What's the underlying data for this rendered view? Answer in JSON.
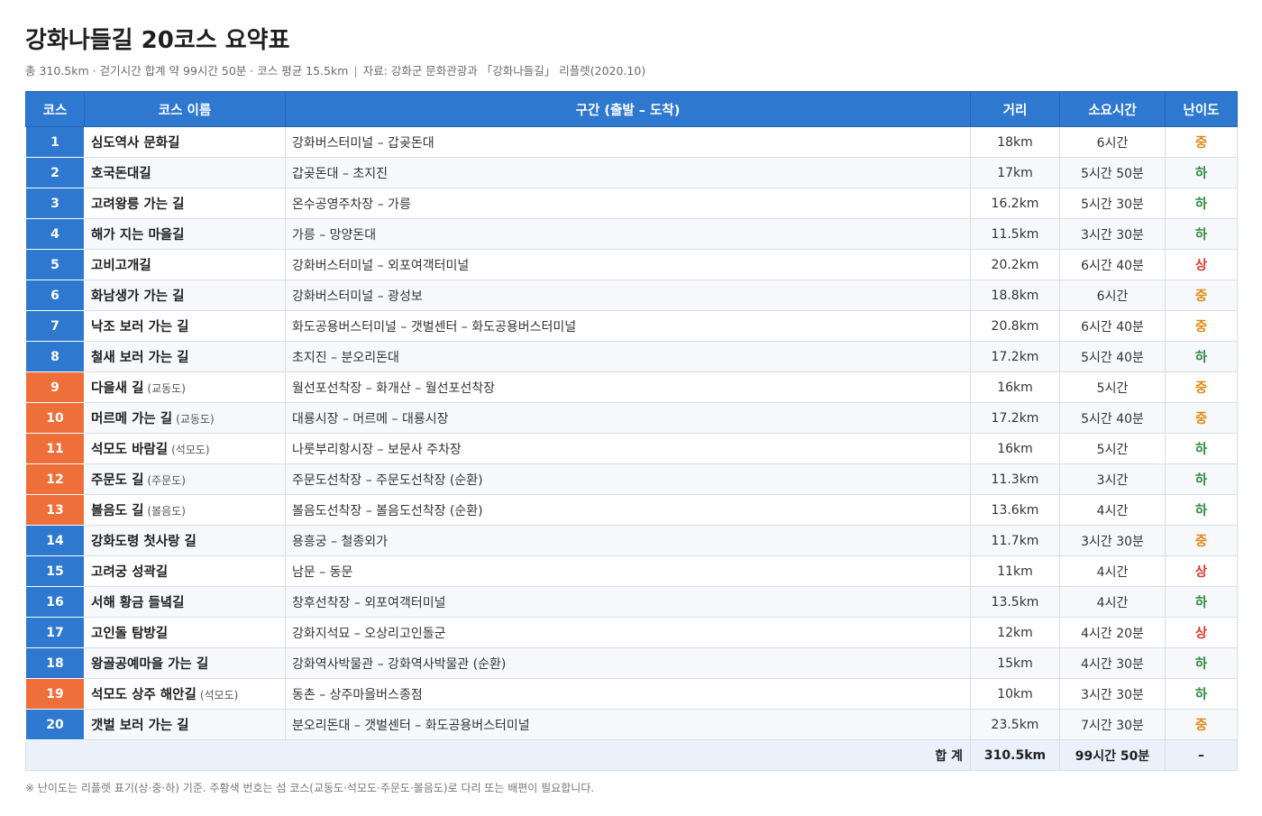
{
  "header": {
    "title": "강화나들길 20코스 요약표",
    "summary": "총 310.5km · 걷기시간 합계 약 99시간 50분 · 코스 평균 15.5km",
    "separator": "|",
    "source": "자료: 강화군 문화관광과 「강화나들길」 리플렛(2020.10)"
  },
  "colors": {
    "header_blue": "#2e78d0",
    "island_orange": "#ee6f3a",
    "diff_high": "#d93a2b",
    "diff_mid": "#e08a13",
    "diff_low": "#2f8a3f"
  },
  "table": {
    "columns": [
      "코스",
      "코스 이름",
      "구간 (출발 – 도착)",
      "거리",
      "소요시간",
      "난이도"
    ],
    "rows": [
      {
        "no": "1",
        "name": "심도역사 문화길",
        "island": "",
        "route": "강화버스터미널 – 갑곶돈대",
        "distance": "18km",
        "time": "6시간",
        "difficulty": "중",
        "level": "mid",
        "color": "blue"
      },
      {
        "no": "2",
        "name": "호국돈대길",
        "island": "",
        "route": "갑곶돈대 – 초지진",
        "distance": "17km",
        "time": "5시간 50분",
        "difficulty": "하",
        "level": "low",
        "color": "blue"
      },
      {
        "no": "3",
        "name": "고려왕릉 가는 길",
        "island": "",
        "route": "온수공영주차장 – 가릉",
        "distance": "16.2km",
        "time": "5시간 30분",
        "difficulty": "하",
        "level": "low",
        "color": "blue"
      },
      {
        "no": "4",
        "name": "해가 지는 마을길",
        "island": "",
        "route": "가릉 – 망양돈대",
        "distance": "11.5km",
        "time": "3시간 30분",
        "difficulty": "하",
        "level": "low",
        "color": "blue"
      },
      {
        "no": "5",
        "name": "고비고개길",
        "island": "",
        "route": "강화버스터미널 – 외포여객터미널",
        "distance": "20.2km",
        "time": "6시간 40분",
        "difficulty": "상",
        "level": "high",
        "color": "blue"
      },
      {
        "no": "6",
        "name": "화남생가 가는 길",
        "island": "",
        "route": "강화버스터미널 – 광성보",
        "distance": "18.8km",
        "time": "6시간",
        "difficulty": "중",
        "level": "mid",
        "color": "blue"
      },
      {
        "no": "7",
        "name": "낙조 보러 가는 길",
        "island": "",
        "route": "화도공용버스터미널 – 갯벌센터 – 화도공용버스터미널",
        "distance": "20.8km",
        "time": "6시간 40분",
        "difficulty": "중",
        "level": "mid",
        "color": "blue"
      },
      {
        "no": "8",
        "name": "철새 보러 가는 길",
        "island": "",
        "route": "초지진 – 분오리돈대",
        "distance": "17.2km",
        "time": "5시간 40분",
        "difficulty": "하",
        "level": "low",
        "color": "blue"
      },
      {
        "no": "9",
        "name": "다을새 길",
        "island": "(교동도)",
        "route": "월선포선착장 – 화개산 – 월선포선착장",
        "distance": "16km",
        "time": "5시간",
        "difficulty": "중",
        "level": "mid",
        "color": "orange"
      },
      {
        "no": "10",
        "name": "머르메 가는 길",
        "island": "(교동도)",
        "route": "대룡시장 – 머르메 – 대룡시장",
        "distance": "17.2km",
        "time": "5시간 40분",
        "difficulty": "중",
        "level": "mid",
        "color": "orange"
      },
      {
        "no": "11",
        "name": "석모도 바람길",
        "island": "(석모도)",
        "route": "나룻부리항시장 – 보문사 주차장",
        "distance": "16km",
        "time": "5시간",
        "difficulty": "하",
        "level": "low",
        "color": "orange"
      },
      {
        "no": "12",
        "name": "주문도 길",
        "island": "(주문도)",
        "route": "주문도선착장 – 주문도선착장 (순환)",
        "distance": "11.3km",
        "time": "3시간",
        "difficulty": "하",
        "level": "low",
        "color": "orange"
      },
      {
        "no": "13",
        "name": "볼음도 길",
        "island": "(볼음도)",
        "route": "볼음도선착장 – 볼음도선착장 (순환)",
        "distance": "13.6km",
        "time": "4시간",
        "difficulty": "하",
        "level": "low",
        "color": "orange"
      },
      {
        "no": "14",
        "name": "강화도령 첫사랑 길",
        "island": "",
        "route": "용흥궁 – 철종외가",
        "distance": "11.7km",
        "time": "3시간 30분",
        "difficulty": "중",
        "level": "mid",
        "color": "blue"
      },
      {
        "no": "15",
        "name": "고려궁 성곽길",
        "island": "",
        "route": "남문 – 동문",
        "distance": "11km",
        "time": "4시간",
        "difficulty": "상",
        "level": "high",
        "color": "blue"
      },
      {
        "no": "16",
        "name": "서해 황금 들녘길",
        "island": "",
        "route": "창후선착장 – 외포여객터미널",
        "distance": "13.5km",
        "time": "4시간",
        "difficulty": "하",
        "level": "low",
        "color": "blue"
      },
      {
        "no": "17",
        "name": "고인돌 탐방길",
        "island": "",
        "route": "강화지석묘 – 오상리고인돌군",
        "distance": "12km",
        "time": "4시간 20분",
        "difficulty": "상",
        "level": "high",
        "color": "blue"
      },
      {
        "no": "18",
        "name": "왕골공예마을 가는 길",
        "island": "",
        "route": "강화역사박물관 – 강화역사박물관 (순환)",
        "distance": "15km",
        "time": "4시간 30분",
        "difficulty": "하",
        "level": "low",
        "color": "blue"
      },
      {
        "no": "19",
        "name": "석모도 상주 해안길",
        "island": "(석모도)",
        "route": "동촌 – 상주마을버스종점",
        "distance": "10km",
        "time": "3시간 30분",
        "difficulty": "하",
        "level": "low",
        "color": "orange"
      },
      {
        "no": "20",
        "name": "갯벌 보러 가는 길",
        "island": "",
        "route": "분오리돈대 – 갯벌센터 – 화도공용버스터미널",
        "distance": "23.5km",
        "time": "7시간 30분",
        "difficulty": "중",
        "level": "mid",
        "color": "blue"
      }
    ],
    "total": {
      "label": "합 계",
      "distance": "310.5km",
      "time": "99시간 50분",
      "difficulty": "–"
    }
  },
  "footnote": "※ 난이도는 리플렛 표기(상·중·하) 기준. 주황색 번호는 섬 코스(교동도·석모도·주문도·볼음도)로 다리 또는 배편이 필요합니다."
}
